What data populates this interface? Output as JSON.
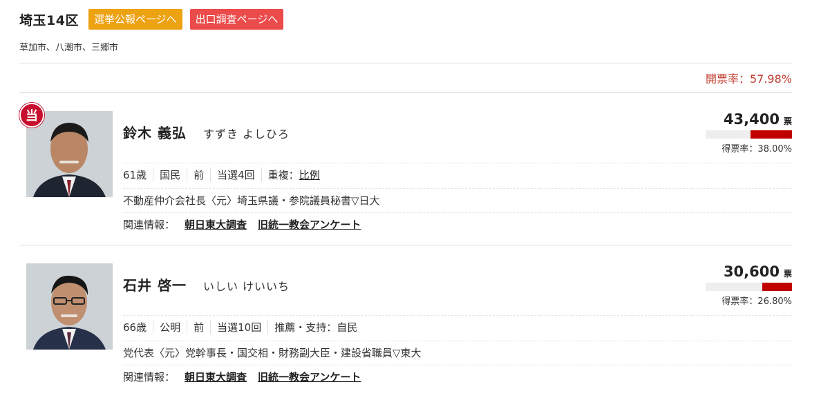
{
  "header": {
    "district": "埼玉14区",
    "koho_button": "選挙公報ページへ",
    "exit_poll_button": "出口調査ページへ",
    "cities": "草加市、八潮市、三郷市",
    "turnout": "開票率：57.98%"
  },
  "colors": {
    "orange": "#eda212",
    "red": "#ec4b4b",
    "bar": "#c00000",
    "turnout": "#c0392b"
  },
  "candidates": [
    {
      "winner_badge": "当",
      "name": "鈴木 義弘",
      "kana": "すずき よしひろ",
      "votes": "43,400",
      "votes_unit": "票",
      "share": "得票率：38.00%",
      "share_value": 0.38,
      "age": "61歳",
      "party": "国民",
      "status": "前",
      "terms": "当選4回",
      "extra_label": "重複：",
      "extra_link": "比例",
      "career": "不動産仲介会社長〈元〉埼玉県議・参院議員秘書▽日大",
      "related_label": "関連情報：",
      "related_links": [
        "朝日東大調査",
        "旧統一教会アンケート"
      ],
      "photo_icon": "portrait-photo"
    },
    {
      "name": "石井 啓一",
      "kana": "いしい けいいち",
      "votes": "30,600",
      "votes_unit": "票",
      "share": "得票率：26.80%",
      "share_value": 0.268,
      "age": "66歳",
      "party": "公明",
      "status": "前",
      "terms": "当選10回",
      "extra_label": "推薦・支持：自民",
      "career": "党代表〈元〉党幹事長・国交相・財務副大臣・建設省職員▽東大",
      "related_label": "関連情報：",
      "related_links": [
        "朝日東大調査",
        "旧統一教会アンケート"
      ],
      "photo_icon": "portrait-photo"
    }
  ]
}
